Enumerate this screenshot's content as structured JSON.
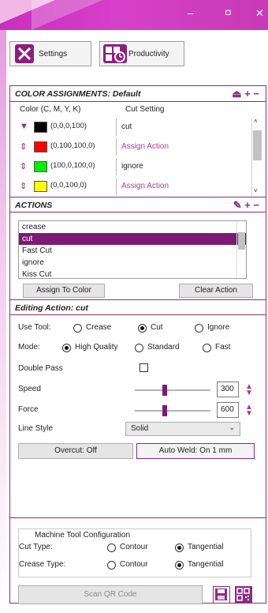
{
  "window": {
    "minimize": "–",
    "restore": "◘",
    "close": "✕"
  },
  "toolbar": {
    "settings_label": "Settings",
    "productivity_label": "Productivity"
  },
  "color_assignments": {
    "title": "COLOR ASSIGNMENTS: Default",
    "icons": "⏏ + −",
    "col_color": "Color (C, M, Y, K)",
    "col_cut": "Cut Setting",
    "rows": [
      {
        "arrow": "▼",
        "swatch": "#000000",
        "cmyk": "(0,0,0,100)",
        "cut": "cut",
        "purple": false
      },
      {
        "arrow": "⇕",
        "swatch": "#ff0000",
        "cmyk": "(0,100,100,0)",
        "cut": "Assign Action",
        "purple": true
      },
      {
        "arrow": "⇕",
        "swatch": "#00ee00",
        "cmyk": "(100,0,100,0)",
        "cut": "ignore",
        "purple": false
      },
      {
        "arrow": "⇕",
        "swatch": "#ffff00",
        "cmyk": "(0,0,100,0)",
        "cut": "Assign Action",
        "purple": true
      }
    ]
  },
  "actions": {
    "title": "ACTIONS",
    "icons": "✎ + −",
    "items": [
      "crease",
      "cut",
      "Fast Cut",
      "ignore",
      "Kiss Cut"
    ],
    "selected_index": 1,
    "assign_label": "Assign To Color",
    "clear_label": "Clear Action"
  },
  "editing": {
    "title": "Editing Action: cut",
    "use_tool_label": "Use Tool:",
    "tools": [
      "Crease",
      "Cut",
      "Ignore"
    ],
    "tool_selected": 1,
    "mode_label": "Mode:",
    "modes": [
      "High Quality",
      "Standard",
      "Fast"
    ],
    "mode_selected": 0,
    "double_pass_label": "Double Pass",
    "speed_label": "Speed",
    "speed_value": "300",
    "speed_level": 0.4,
    "force_label": "Force",
    "force_value": "600",
    "force_level": 0.4,
    "line_style_label": "Line Style",
    "line_style_value": "Solid",
    "overcut_label": "Overcut: Off",
    "autoweld_label": "Auto Weld: On 1 mm"
  },
  "machine": {
    "title": "Machine Tool Configuration",
    "cut_type_label": "Cut Type:",
    "crease_type_label": "Crease Type:",
    "options": [
      "Contour",
      "Tangential"
    ],
    "cut_selected": 1,
    "crease_selected": 1
  },
  "footer": {
    "scan_label": "Scan QR Code"
  },
  "colors": {
    "accent": "#8a2d82",
    "selection": "#7c1b73",
    "titlebar": "#d03fc4"
  }
}
